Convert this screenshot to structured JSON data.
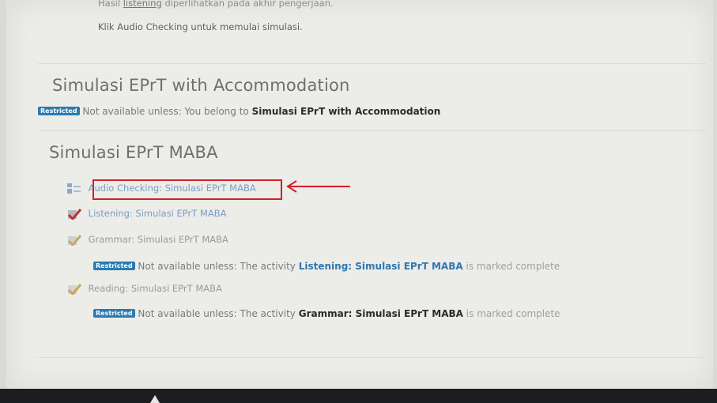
{
  "intro": {
    "cut_line_a": "Hasil",
    "cut_line_link": "listening",
    "cut_line_b": "diperlihatkan pada akhir pengerjaan.",
    "instruction": "Klik Audio Checking untuk memulai simulasi."
  },
  "section_accommodation": {
    "title": "Simulasi EPrT with Accommodation",
    "restriction": {
      "badge": "Restricted",
      "text": "Not available unless: You belong to",
      "target": "Simulasi EPrT with Accommodation"
    }
  },
  "section_maba": {
    "title": "Simulasi EPrT MABA",
    "activities": [
      {
        "label": "Audio Checking: Simulasi EPrT MABA",
        "icon": "page-icon"
      },
      {
        "label": "Listening: Simulasi EPrT MABA",
        "icon": "checkmark-icon"
      },
      {
        "label": "Grammar: Simulasi EPrT MABA",
        "icon": "checkmark-icon"
      },
      {
        "label": "Reading: Simulasi EPrT MABA",
        "icon": "checkmark-icon"
      }
    ],
    "restrictions": [
      {
        "badge": "Restricted",
        "text": "Not available unless: The activity",
        "target": "Listening: Simulasi EPrT MABA",
        "suffix": "is marked complete"
      },
      {
        "badge": "Restricted",
        "text": "Not available unless: The activity",
        "target": "Grammar: Simulasi EPrT MABA",
        "suffix": "is marked complete"
      }
    ]
  },
  "annotation": {
    "box_color": "#d41f28",
    "arrow_icon": "left-arrow-icon"
  },
  "colors": {
    "badge": "#2a7bb0",
    "link": "#2f77b0",
    "activity_link": "#7a9ec3"
  }
}
